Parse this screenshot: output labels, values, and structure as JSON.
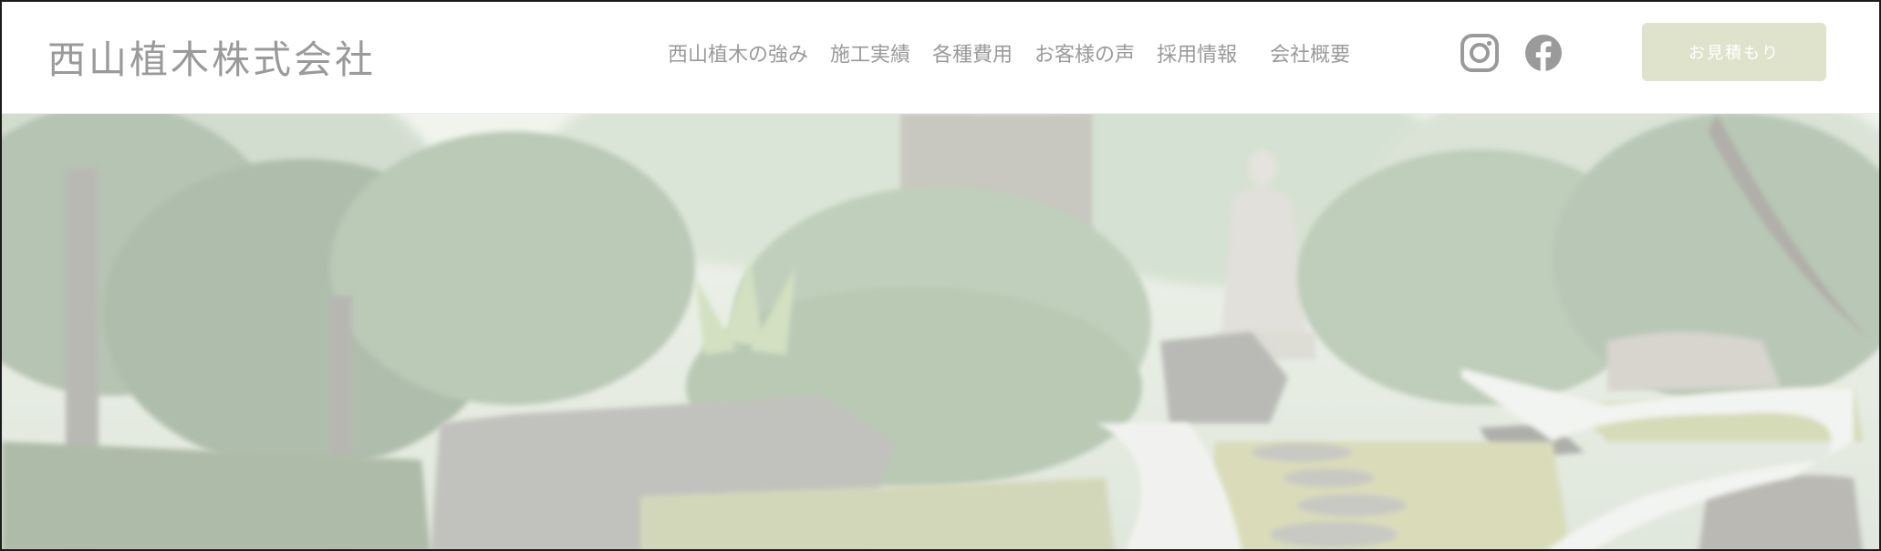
{
  "header": {
    "logo_text": "西山植木株式会社",
    "nav": [
      {
        "label": "西山植木の強み"
      },
      {
        "label": "施工実績"
      },
      {
        "label": "各種費用"
      },
      {
        "label": "お客様の声"
      },
      {
        "label": "採用情報"
      },
      {
        "label": "会社概要"
      }
    ],
    "social": [
      {
        "icon": "instagram-icon"
      },
      {
        "icon": "facebook-icon"
      }
    ],
    "cta_label": "お見積もり"
  },
  "colors": {
    "text_gray": "#9a9a9a",
    "cta_background": "#dfe3cc",
    "cta_text": "#ffffff",
    "border": "#1c1c1c"
  }
}
